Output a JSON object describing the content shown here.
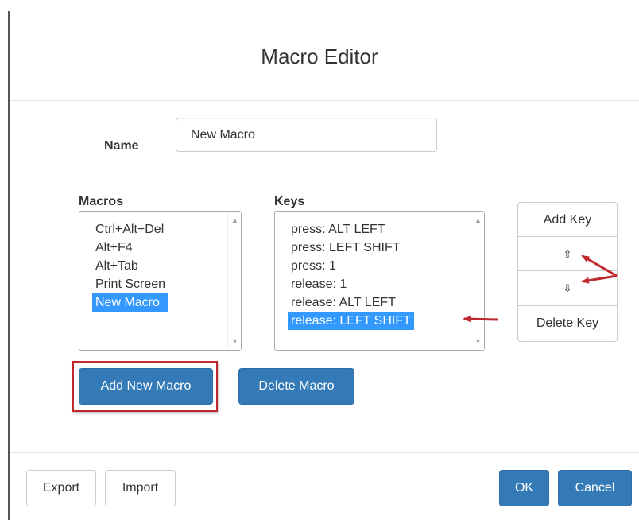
{
  "dialog": {
    "title": "Macro Editor",
    "name_label": "Name",
    "name_value": "New Macro"
  },
  "macros": {
    "label": "Macros",
    "items": [
      "Ctrl+Alt+Del",
      "Alt+F4",
      "Alt+Tab",
      "Print Screen",
      "New Macro"
    ],
    "selected_index": 4
  },
  "keys": {
    "label": "Keys",
    "items": [
      "press: ALT LEFT",
      "press: LEFT SHIFT",
      "press: 1",
      "release: 1",
      "release: ALT LEFT",
      "release: LEFT SHIFT"
    ],
    "selected_index": 5
  },
  "key_actions": {
    "add_key": "Add Key",
    "move_up": "⇧",
    "move_down": "⇩",
    "delete_key": "Delete Key"
  },
  "macro_actions": {
    "add_new_macro": "Add New Macro",
    "delete_macro": "Delete Macro"
  },
  "footer": {
    "export": "Export",
    "import": "Import",
    "ok": "OK",
    "cancel": "Cancel"
  },
  "colors": {
    "primary": "#337ab7",
    "selection": "#3399ff",
    "annotation": "#c0282d"
  }
}
